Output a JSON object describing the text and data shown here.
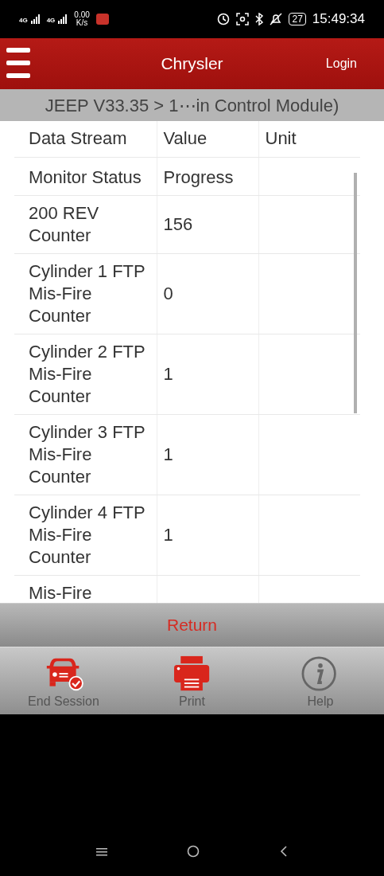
{
  "status_bar": {
    "network_labels": [
      "4G",
      "4G"
    ],
    "speed": "0.00",
    "speed_unit": "K/s",
    "battery": "27",
    "time": "15:49:34"
  },
  "header": {
    "title": "Chrysler",
    "login": "Login"
  },
  "breadcrumb": "JEEP V33.35 > 1⋯in Control Module)",
  "table": {
    "columns": [
      "Data Stream",
      "Value",
      "Unit"
    ],
    "rows": [
      {
        "name": "Monitor Status",
        "value": "Progress"
      },
      {
        "name": "200 REV Counter",
        "value": "156"
      },
      {
        "name": "Cylinder 1 FTP Mis-Fire Counter",
        "value": "0"
      },
      {
        "name": "Cylinder 2 FTP Mis-Fire Counter",
        "value": "1"
      },
      {
        "name": "Cylinder 3 FTP Mis-Fire Counter",
        "value": "1"
      },
      {
        "name": "Cylinder 4 FTP Mis-Fire Counter",
        "value": "1"
      },
      {
        "name": "Mis-Fire"
      }
    ]
  },
  "return_button": "Return",
  "toolbar": [
    {
      "kind": "car",
      "label": "End Session"
    },
    {
      "kind": "printer",
      "label": "Print"
    },
    {
      "kind": "info",
      "label": "Help"
    }
  ]
}
